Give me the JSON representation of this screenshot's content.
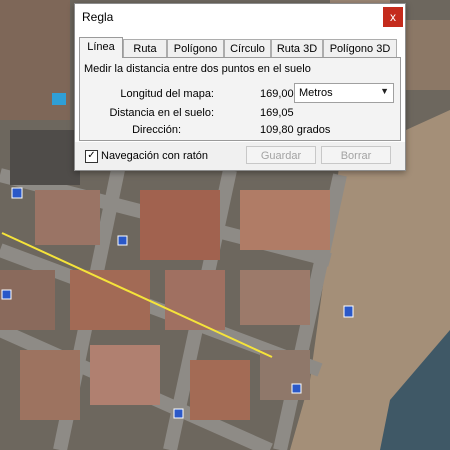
{
  "dialog": {
    "title": "Regla",
    "close_glyph": "x",
    "tabs": [
      "Línea",
      "Ruta",
      "Polígono",
      "Círculo",
      "Ruta 3D",
      "Polígono 3D"
    ],
    "active_tab": "Línea",
    "description": "Medir la distancia entre dos puntos en el suelo",
    "map_length_label": "Longitud del mapa:",
    "map_length_value": "169,00",
    "unit_selected": "Metros",
    "ground_distance_label": "Distancia en el suelo:",
    "ground_distance_value": "169,05",
    "direction_label": "Dirección:",
    "direction_value": "109,80 grados",
    "navigation_checkbox_label": "Navegación con ratón",
    "navigation_checked": true,
    "save_button": "Guardar",
    "clear_button": "Borrar"
  },
  "colors": {
    "measure_line": "#f5e33a",
    "close_button": "#c42b1c",
    "placemark_blue": "#2a58c8"
  },
  "map_icons": [
    "balloon-icon",
    "info-icon",
    "restaurant-icon",
    "bar-icon"
  ]
}
